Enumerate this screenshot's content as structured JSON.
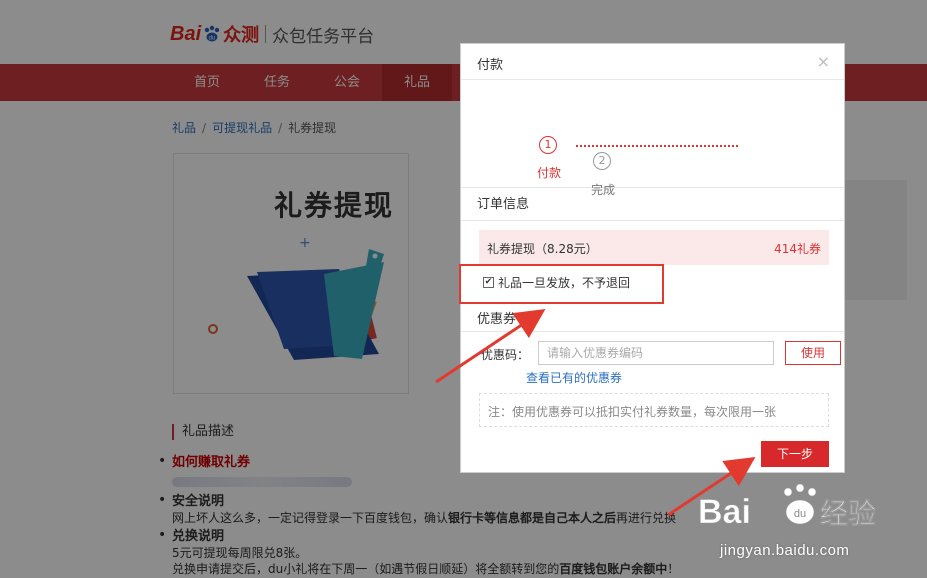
{
  "header": {
    "logo_text": "Bai",
    "logo_brand": "众测",
    "platform_name": "众包任务平台"
  },
  "nav": {
    "items": [
      "首页",
      "任务",
      "公会",
      "礼品"
    ],
    "active_index": 3
  },
  "breadcrumb": {
    "items": [
      "礼品",
      "可提现礼品",
      "礼券提现"
    ]
  },
  "product": {
    "title": "礼券提现"
  },
  "description": {
    "heading": "礼品描述",
    "how_to_earn": "如何赚取礼券",
    "safety_title": "安全说明",
    "safety_text_1": "网上坏人这么多，一定记得登录一下百度钱包，确认",
    "safety_text_bold": "银行卡等信息都是自己本人之后",
    "safety_text_2": "再进行兑换",
    "exchange_title": "兑换说明",
    "exchange_line_1": "5元可提现每周限兑8张。",
    "exchange_line_2a": "兑换申请提交后，du小礼将在下周一（如遇节假日顺延）将全额转到您的",
    "exchange_line_2b": "百度钱包账户余额中",
    "exchange_line_2c": "！"
  },
  "modal": {
    "title": "付款",
    "close_symbol": "×",
    "steps": [
      {
        "number": "1",
        "label": "付款",
        "active": true
      },
      {
        "number": "2",
        "label": "完成",
        "active": false
      }
    ],
    "order_section_title": "订单信息",
    "order_item_name": "礼券提现（8.28元）",
    "order_item_price": "414礼券",
    "agree_text": "礼品一旦发放，不予退回",
    "agree_checked": true,
    "coupon_section_title": "优惠券",
    "coupon_label": "优惠码：",
    "coupon_placeholder": "请输入优惠券编码",
    "use_button": "使用",
    "view_coupons_link": "查看已有的优惠券",
    "note": "注：使用优惠券可以抵扣实付礼券数量，每次限用一张",
    "next_button": "下一步"
  },
  "watermark": {
    "brand": "Baidu经验",
    "url": "jingyan.baidu.com"
  },
  "colors": {
    "brand_red": "#c8393c",
    "button_red": "#d7282b",
    "link_blue": "#2e6fbc",
    "annotation_red": "#e23a2e"
  }
}
